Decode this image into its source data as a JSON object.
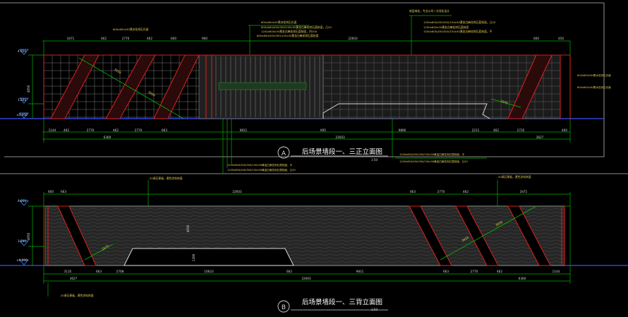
{
  "elevation_a": {
    "title": "后场景墙段一、三正立面图",
    "marker": "A",
    "scale_note": "1:50",
    "levels": [
      "4.050",
      "1.200",
      "±0.000"
    ],
    "height_dim": "4050",
    "top_dims": [
      "3471",
      "462",
      "2770",
      "462",
      "600",
      "900",
      "22603",
      "600",
      "450"
    ],
    "bottom_dims_1": [
      "1144",
      "462",
      "2770",
      "462",
      "2770",
      "663",
      "9811",
      "695",
      "9890",
      "2211",
      "462",
      "2735",
      "400"
    ],
    "bottom_dims_2": [
      "6360",
      "22603",
      "3627"
    ],
    "notes_top": [
      "600x600x30黑冰花岗石光面",
      "600x600/450/300/150x30黄金白麻花岗石荔枝面，凸20",
      "1200x600x30黄金白麻花岗石荔枝面，凹100",
      "600x600/450/300/150x30黄金白麻花岗石荔枝面",
      "底层绿化，专业公司二次深化设计",
      "1500x600/450/300/150x30黄金白麻花岗石荔枝面，凸20",
      "1200x600x30黄金白麻花岗石荔枝面",
      "1500x600/450/300/150x30黄金白麻花岗石荔枝面，平"
    ],
    "notes_right": [
      "600x600x30黑冰花岗石光面",
      "600x600x30黑冰花岗石光面"
    ],
    "notes_bottom": [
      "1200x600/450/300/150x30黄金白麻花岗石荔枝面，平",
      "1200x600/450/300/150x30黄金白麻花岗石荔枝面，凸20",
      "1200x600/450/300/150x30黄金白麻花岗石荔枝面，平",
      "1200x600/450/300/150x30黄金白麻花岗石荔枝面，凸20"
    ],
    "diag_dims": [
      "3959",
      "3959",
      "1575"
    ]
  },
  "elevation_b": {
    "title": "后场景墙段一、三背立面图",
    "marker": "B",
    "scale_note": "1:50",
    "levels": [
      "4.050",
      "1.200",
      "±0.000"
    ],
    "height_dim": "4050",
    "top_dims": [
      "600",
      "663",
      "22603",
      "663",
      "2770",
      "462",
      "3471"
    ],
    "bottom_dims_1": [
      "3135",
      "663",
      "2708",
      "10623",
      "662",
      "9811",
      "663",
      "2770",
      "462",
      "1144"
    ],
    "bottom_dims_2": [
      "3627",
      "22603",
      "6360"
    ],
    "mid_dim": "1200",
    "wall_height": "4050",
    "note_top_left": "20厚石膏板，黄色涂料饰面",
    "note_top_right": "20厚石膏板，黄色涂料饰面",
    "note_bottom_left": "20厚石膏板，黄色涂料饰面",
    "diag_dims": [
      "1575",
      "3959",
      "3959"
    ]
  },
  "colors": {
    "background": "#000000",
    "line_white": "#d9d9d9",
    "line_green": "#00c000",
    "line_red": "#d02020",
    "line_blue": "#3a4fff",
    "text_yellow": "#e8d25a",
    "text_cyan": "#40d0d0"
  }
}
